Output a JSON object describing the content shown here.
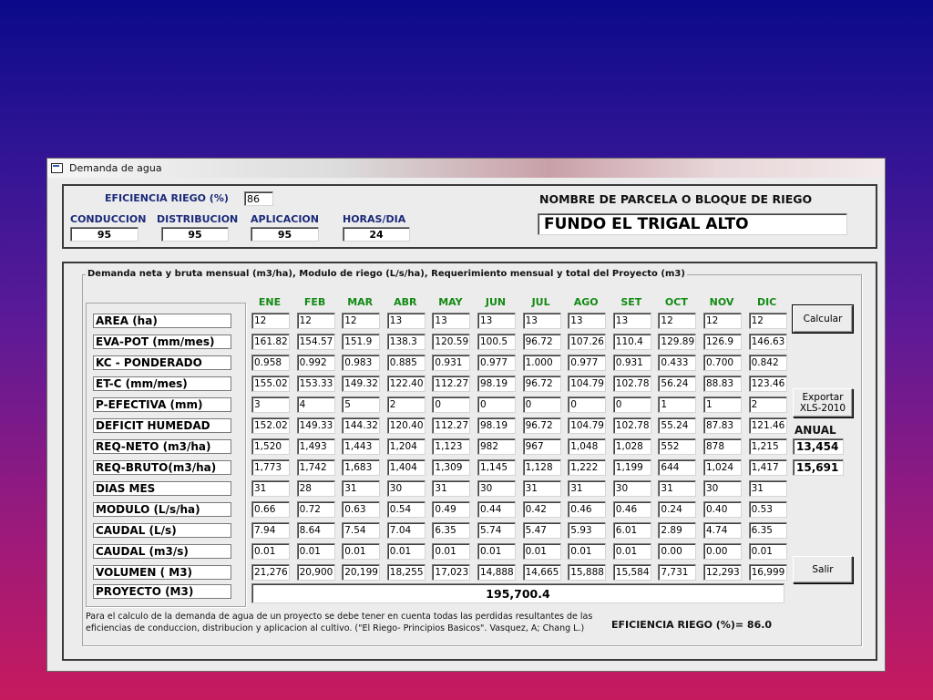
{
  "window": {
    "title": "Demanda de agua"
  },
  "top": {
    "eficiencia_label": "EFICIENCIA  RIEGO (%)",
    "eficiencia_value": "86",
    "conduccion_label": "CONDUCCION",
    "conduccion_value": "95",
    "distribucion_label": "DISTRIBUCION",
    "distribucion_value": "95",
    "aplicacion_label": "APLICACION",
    "aplicacion_value": "95",
    "horas_label": "HORAS/DIA",
    "horas_value": "24",
    "parcela_label": "NOMBRE DE PARCELA O  BLOQUE DE RIEGO",
    "parcela_value": "FUNDO EL TRIGAL ALTO"
  },
  "main": {
    "legend": "Demanda neta y bruta mensual (m3/ha), Modulo de riego (L/s/ha), Requerimiento mensual y total del Proyecto (m3)",
    "months": [
      "ENE",
      "FEB",
      "MAR",
      "ABR",
      "MAY",
      "JUN",
      "JUL",
      "AGO",
      "SET",
      "OCT",
      "NOV",
      "DIC"
    ],
    "rows": [
      {
        "label": "AREA (ha)",
        "values": [
          "12",
          "12",
          "12",
          "13",
          "13",
          "13",
          "13",
          "13",
          "13",
          "12",
          "12",
          "12"
        ]
      },
      {
        "label": "EVA-POT (mm/mes)",
        "values": [
          "161.82",
          "154.57",
          "151.9",
          "138.3",
          "120.59",
          "100.5",
          "96.72",
          "107.26",
          "110.4",
          "129.89",
          "126.9",
          "146.63"
        ]
      },
      {
        "label": "KC - PONDERADO",
        "values": [
          "0.958",
          "0.992",
          "0.983",
          "0.885",
          "0.931",
          "0.977",
          "1.000",
          "0.977",
          "0.931",
          "0.433",
          "0.700",
          "0.842"
        ]
      },
      {
        "label": "ET-C (mm/mes)",
        "values": [
          "155.02",
          "153.33",
          "149.32",
          "122.40",
          "112.27",
          "98.19",
          "96.72",
          "104.79",
          "102.78",
          "56.24",
          "88.83",
          "123.46"
        ]
      },
      {
        "label": "P-EFECTIVA (mm)",
        "values": [
          "3",
          "4",
          "5",
          "2",
          "0",
          "0",
          "0",
          "0",
          "0",
          "1",
          "1",
          "2"
        ]
      },
      {
        "label": "DEFICIT HUMEDAD",
        "values": [
          "152.02",
          "149.33",
          "144.32",
          "120.40",
          "112.27",
          "98.19",
          "96.72",
          "104.79",
          "102.78",
          "55.24",
          "87.83",
          "121.46"
        ]
      },
      {
        "label": "REQ-NETO (m3/ha)",
        "values": [
          "1,520",
          "1,493",
          "1,443",
          "1,204",
          "1,123",
          "982",
          "967",
          "1,048",
          "1,028",
          "552",
          "878",
          "1,215"
        ]
      },
      {
        "label": "REQ-BRUTO(m3/ha)",
        "values": [
          "1,773",
          "1,742",
          "1,683",
          "1,404",
          "1,309",
          "1,145",
          "1,128",
          "1,222",
          "1,199",
          "644",
          "1,024",
          "1,417"
        ]
      },
      {
        "label": "DIAS MES",
        "values": [
          "31",
          "28",
          "31",
          "30",
          "31",
          "30",
          "31",
          "31",
          "30",
          "31",
          "30",
          "31"
        ]
      },
      {
        "label": "MODULO  (L/s/ha)",
        "values": [
          "0.66",
          "0.72",
          "0.63",
          "0.54",
          "0.49",
          "0.44",
          "0.42",
          "0.46",
          "0.46",
          "0.24",
          "0.40",
          "0.53"
        ]
      },
      {
        "label": "CAUDAL (L/s)",
        "values": [
          "7.94",
          "8.64",
          "7.54",
          "7.04",
          "6.35",
          "5.74",
          "5.47",
          "5.93",
          "6.01",
          "2.89",
          "4.74",
          "6.35"
        ]
      },
      {
        "label": "CAUDAL (m3/s)",
        "values": [
          "0.01",
          "0.01",
          "0.01",
          "0.01",
          "0.01",
          "0.01",
          "0.01",
          "0.01",
          "0.01",
          "0.00",
          "0.00",
          "0.01"
        ]
      },
      {
        "label": "VOLUMEN ( M3)",
        "values": [
          "21,276",
          "20,900",
          "20,199",
          "18,255",
          "17,023",
          "14,888",
          "14,665",
          "15,888",
          "15,584",
          "7,731",
          "12,293",
          "16,999"
        ]
      }
    ],
    "proyecto_label": "PROYECTO (M3)",
    "proyecto_value": "195,700.4",
    "anual_label": "ANUAL",
    "anual_neto": "13,454",
    "anual_bruto": "15,691",
    "calcular_label": "Calcular",
    "exportar_label_1": "Exportar",
    "exportar_label_2": "XLS-2010",
    "salir_label": "Salir",
    "note_line1": "Para el calculo de la demanda de agua de un proyecto se debe tener en cuenta todas las perdidas resultantes de las",
    "note_line2": "eficiencias de conduccion, distribucion y aplicacion al cultivo. (\"El Riego- Principios Basicos\". Vasquez, A; Chang L.)",
    "eficiencia_summary": "EFICIENCIA  RIEGO (%)=  86.0"
  }
}
